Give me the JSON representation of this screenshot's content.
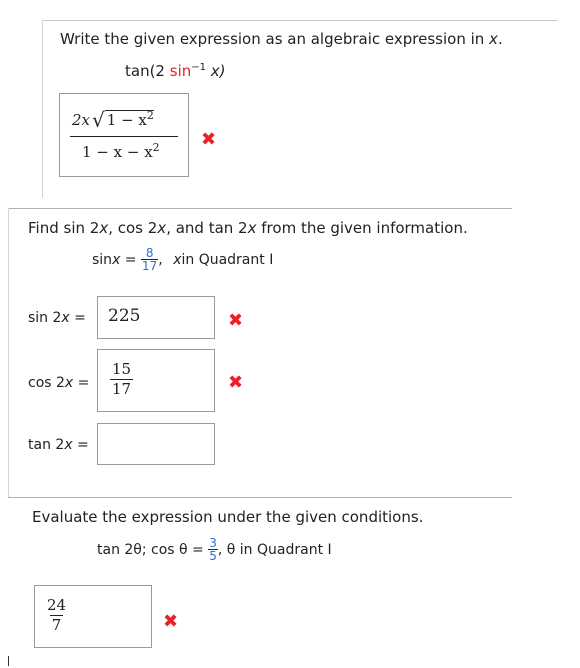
{
  "q1": {
    "prompt_prefix": "Write the given expression as an algebraic expression in ",
    "prompt_var": "x",
    "prompt_suffix": ".",
    "expr_fn": "tan(2 ",
    "expr_inv": "sin",
    "expr_sup": "−1",
    "expr_var": " x)",
    "answer_num_a": "2x",
    "answer_num_rad": "1 − x",
    "answer_num_exp": "2",
    "answer_den": "1 − x − x",
    "answer_den_exp": "2",
    "status": "incorrect"
  },
  "q2": {
    "prompt_a": "Find sin 2",
    "prompt_x1": "x",
    "prompt_b": ", cos 2",
    "prompt_x2": "x",
    "prompt_c": ", and tan 2",
    "prompt_x3": "x",
    "prompt_d": " from the given information.",
    "given_lhs": "sin ",
    "given_var": "x",
    "given_eq": " = ",
    "given_num": "8",
    "given_den": "17",
    "given_sep": ", ",
    "given_cond_var": "x",
    "given_cond": " in Quadrant I",
    "sin_label": "sin 2",
    "sin_var": "x",
    "sin_eq": " =",
    "sin_value": "225",
    "cos_label": "cos 2",
    "cos_var": "x",
    "cos_eq": " =",
    "cos_num": "15",
    "cos_den": "17",
    "tan_label": "tan 2",
    "tan_var": "x",
    "tan_eq": " =",
    "tan_value": ""
  },
  "q3": {
    "prompt": "Evaluate the expression under the given conditions.",
    "given_expr": "tan 2θ; cos θ = ",
    "given_num": "3",
    "given_den": "5",
    "given_cond": ", θ in Quadrant I",
    "answer_num": "24",
    "answer_den": "7"
  },
  "icons": {
    "wrong": "✖"
  },
  "colors": {
    "wrong": "#e8212b",
    "fraction_given": "#2a6fdb"
  }
}
